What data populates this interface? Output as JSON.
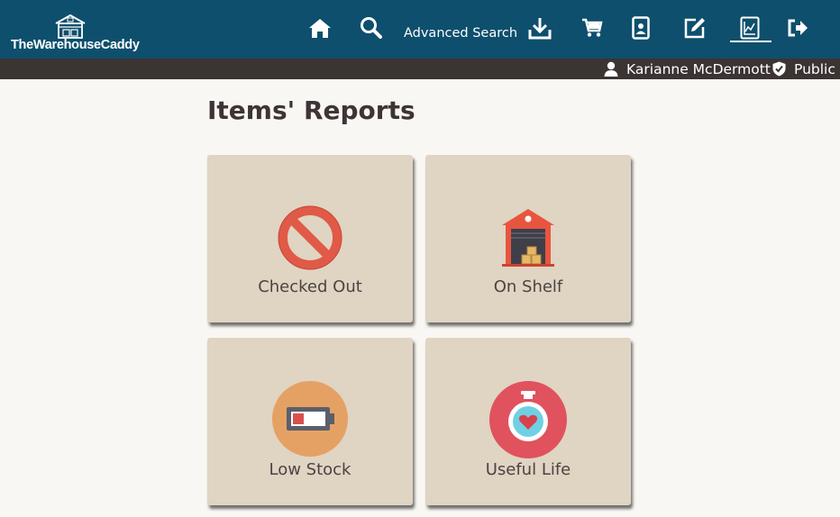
{
  "app": {
    "name": "TheWarehouseCaddy"
  },
  "nav": {
    "items": [
      {
        "name": "home",
        "icon": "home-icon"
      },
      {
        "name": "search",
        "icon": "search-icon"
      },
      {
        "name": "advanced-search",
        "label": "Advanced Search"
      },
      {
        "name": "checkin",
        "icon": "download-icon"
      },
      {
        "name": "cart",
        "icon": "cart-icon"
      },
      {
        "name": "profile",
        "icon": "id-card-icon"
      },
      {
        "name": "edit",
        "icon": "edit-icon"
      },
      {
        "name": "reports",
        "icon": "chart-report-icon",
        "active": true
      },
      {
        "name": "logout",
        "icon": "sign-out-icon"
      }
    ]
  },
  "user": {
    "name": "Karianne McDermott",
    "role": "Public"
  },
  "page": {
    "title": "Items' Reports"
  },
  "reports": [
    {
      "label": "Checked Out",
      "icon": "prohibited-icon"
    },
    {
      "label": "On Shelf",
      "icon": "warehouse-icon"
    },
    {
      "label": "Low Stock",
      "icon": "low-battery-icon"
    },
    {
      "label": "Useful Life",
      "icon": "stopwatch-heart-icon"
    }
  ],
  "colors": {
    "topbar": "#0d4f6d",
    "userbar": "#3b3433",
    "card": "#e0d4c2",
    "background": "#f9f7f3"
  }
}
